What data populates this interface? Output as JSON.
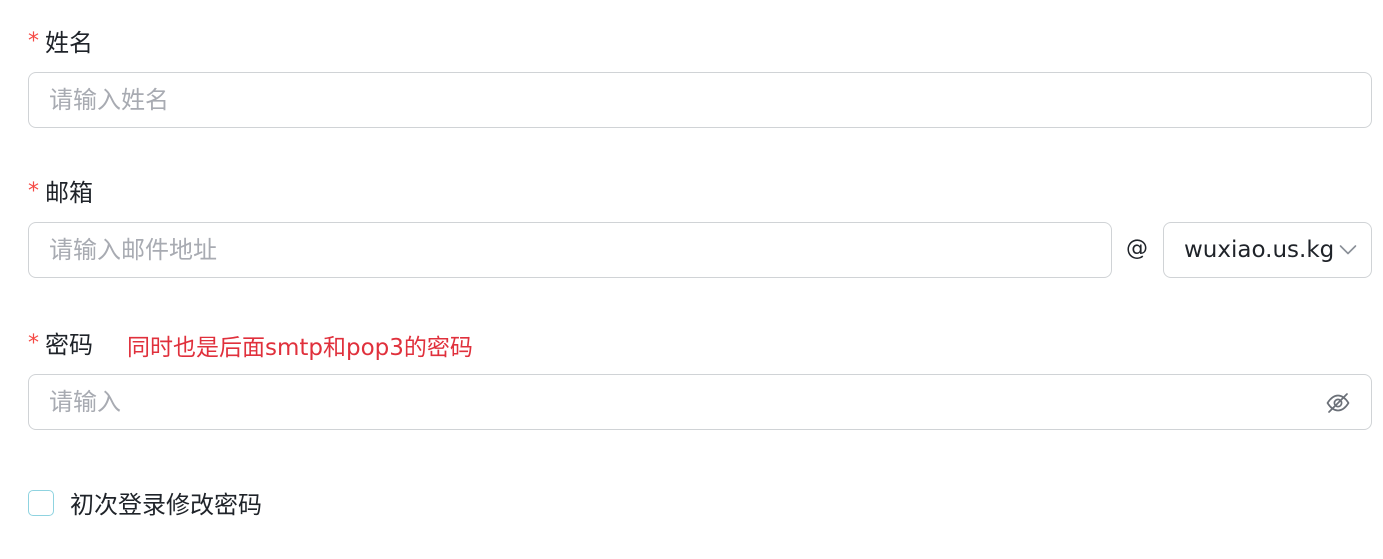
{
  "name_field": {
    "required_mark": "*",
    "label": "姓名",
    "placeholder": "请输入姓名",
    "value": ""
  },
  "email_field": {
    "required_mark": "*",
    "label": "邮箱",
    "placeholder": "请输入邮件地址",
    "value": "",
    "at_symbol": "@",
    "domain_selected": "wuxiao.us.kg"
  },
  "password_field": {
    "required_mark": "*",
    "label": "密码",
    "note": "同时也是后面smtp和pop3的密码",
    "placeholder": "请输入",
    "value": ""
  },
  "first_login_checkbox": {
    "label": "初次登录修改密码",
    "checked": false
  },
  "icons": {
    "domain_dropdown": "chevron-down-icon",
    "password_visibility": "eye-off-icon"
  },
  "colors": {
    "required": "#f54a45",
    "note": "#e0303c",
    "border": "#d0d3d6",
    "placeholder": "#a8abb2",
    "checkbox_border": "#8fd3e0"
  }
}
